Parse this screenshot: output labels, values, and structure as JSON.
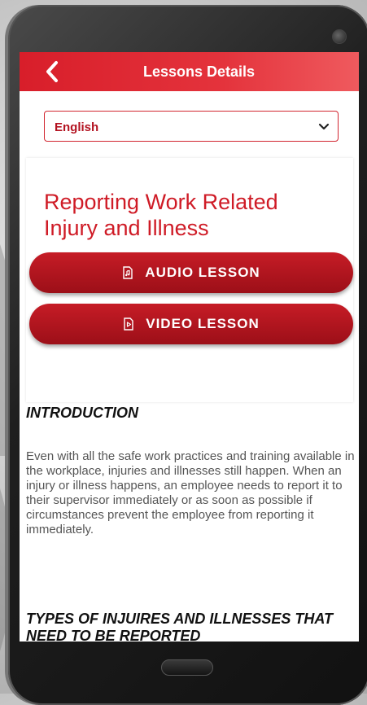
{
  "appbar": {
    "title": "Lessons Details",
    "back_icon": "chevron-left-icon"
  },
  "language_select": {
    "selected": "English",
    "icon": "chevron-down-icon"
  },
  "lesson": {
    "title": "Reporting Work Related Injury and Illness",
    "audio_button": {
      "label": "AUDIO LESSON",
      "icon": "audio-file-icon"
    },
    "video_button": {
      "label": "VIDEO LESSON",
      "icon": "video-file-icon"
    }
  },
  "content": {
    "intro_heading": "INTRODUCTION",
    "intro_text": "Even with all the safe work practices and training available in the workplace, injuries and illnesses still happen. When an injury or illness happens, an employee needs to report it to their supervisor immediately or as soon as possible if circumstances prevent the employee from reporting it immediately.",
    "types_heading": "TYPES OF INJUIRES AND ILLNESSES THAT NEED TO BE REPORTED"
  },
  "colors": {
    "primary": "#d81e2a",
    "button": "#a8131c",
    "phone_frame": "#1f1f1f"
  }
}
